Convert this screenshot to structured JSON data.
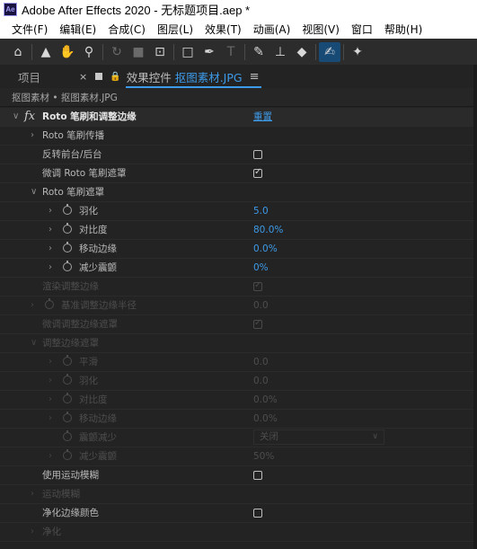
{
  "window": {
    "logo": "Ae",
    "title": "Adobe After Effects 2020 - 无标题项目.aep *"
  },
  "menu": [
    "文件(F)",
    "编辑(E)",
    "合成(C)",
    "图层(L)",
    "效果(T)",
    "动画(A)",
    "视图(V)",
    "窗口",
    "帮助(H)"
  ],
  "toolbar": {
    "tools": [
      {
        "name": "home-icon",
        "glyph": "⌂"
      },
      {
        "name": "selection-tool-icon",
        "glyph": "▲"
      },
      {
        "name": "hand-tool-icon",
        "glyph": "✋"
      },
      {
        "name": "zoom-tool-icon",
        "glyph": "⚲"
      },
      {
        "name": "rotate-tool-icon",
        "glyph": "↻"
      },
      {
        "name": "camera-tool-icon",
        "glyph": "■"
      },
      {
        "name": "pan-behind-tool-icon",
        "glyph": "⊡"
      },
      {
        "name": "rectangle-tool-icon",
        "glyph": "□"
      },
      {
        "name": "pen-tool-icon",
        "glyph": "✒"
      },
      {
        "name": "type-tool-icon",
        "glyph": "T"
      },
      {
        "name": "brush-tool-icon",
        "glyph": "✎"
      },
      {
        "name": "clone-stamp-tool-icon",
        "glyph": "⊥"
      },
      {
        "name": "eraser-tool-icon",
        "glyph": "◆"
      },
      {
        "name": "roto-brush-tool-icon",
        "glyph": "✍"
      },
      {
        "name": "puppet-pin-tool-icon",
        "glyph": "✦"
      }
    ]
  },
  "tabs": {
    "project": "项目",
    "close": "×",
    "effects_label": "效果控件",
    "layer_name": "抠图素材.JPG",
    "menu": "≡"
  },
  "breadcrumb": "抠图素材 • 抠图素材.JPG",
  "effect": {
    "fx": "fx",
    "name": "Roto 笔刷和调整边缘",
    "reset": "重置"
  },
  "properties": {
    "propagation": "Roto 笔刷传播",
    "invert": "反转前台/后台",
    "fine_tune": "微调 Roto 笔刷遮罩",
    "roto_matte": "Roto 笔刷遮罩",
    "feather": {
      "label": "羽化",
      "value": "5.0"
    },
    "contrast": {
      "label": "对比度",
      "value": "80.0%"
    },
    "shift_edge": {
      "label": "移动边缘",
      "value": "0.0%"
    },
    "reduce_chatter": {
      "label": "减少震颤",
      "value": "0%"
    },
    "render_refine": "渲染调整边缘",
    "base_radius": {
      "label": "基准调整边缘半径",
      "value": "0.0"
    },
    "fine_tune_refine": "微调调整边缘遮罩",
    "refine_matte": "调整边缘遮罩",
    "smooth": {
      "label": "平滑",
      "value": "0.0"
    },
    "feather2": {
      "label": "羽化",
      "value": "0.0"
    },
    "contrast2": {
      "label": "对比度",
      "value": "0.0%"
    },
    "shift_edge2": {
      "label": "移动边缘",
      "value": "0.0%"
    },
    "chatter_reduction": {
      "label": "震颤减少",
      "value": "关闭"
    },
    "reduce_chatter2": {
      "label": "减少震颤",
      "value": "50%"
    },
    "use_motion_blur": "使用运动模糊",
    "motion_blur": "运动模糊",
    "decontaminate": "净化边缘颜色",
    "decontamination": "净化"
  },
  "colors": {
    "accent": "#3d9ae8",
    "panel": "#232323",
    "disabled": "#4d4d4d"
  }
}
